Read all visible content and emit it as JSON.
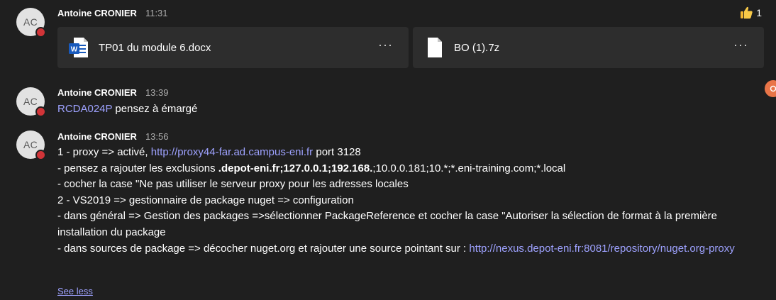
{
  "messages": [
    {
      "avatar_initials": "AC",
      "author": "Antoine CRONIER",
      "time": "11:31",
      "reaction": {
        "count": "1",
        "icon": "thumbs-up-icon"
      },
      "attachments": [
        {
          "name": "TP01 du module 6.docx",
          "icon": "word-doc-icon",
          "more": "···"
        },
        {
          "name": "BO (1).7z",
          "icon": "file-icon",
          "more": "···"
        }
      ]
    },
    {
      "avatar_initials": "AC",
      "author": "Antoine CRONIER",
      "time": "13:39",
      "mention": "RCDA024P",
      "text": " pensez à émargé"
    },
    {
      "avatar_initials": "AC",
      "author": "Antoine CRONIER",
      "time": "13:56",
      "lines": {
        "l1_a": "1 - proxy => activé, ",
        "l1_link": "http://proxy44-far.ad.campus-eni.fr",
        "l1_b": " port 3128",
        "l2_a": "- pensez a rajouter les exclusions ",
        "l2_bold": ".depot-eni.fr;127.0.0.1;192.168.",
        "l2_b": ";10.0.0.181;10.*;*.eni-training.com;*.local",
        "l3": "- cocher la case \"Ne pas utiliser le serveur proxy pour les adresses locales",
        "l4": "2 - VS2019 => gestionnaire de package nuget => configuration",
        "l5": "- dans général => Gestion des packages =>sélectionner PackageReference et cocher la case \"Autoriser la sélection de format à la première installation du package",
        "l6_a": "- dans sources de package => décocher nuget.org et rajouter une source pointant sur : ",
        "l6_link": "http://nexus.depot-eni.fr:8081/repository/nuget.org-proxy"
      },
      "see_less": "See less"
    }
  ],
  "colors": {
    "background": "#1f1f1f",
    "card": "#2d2d2d",
    "link": "#9ea2ff",
    "presence_busy": "#d13438",
    "word_blue": "#185abd"
  }
}
